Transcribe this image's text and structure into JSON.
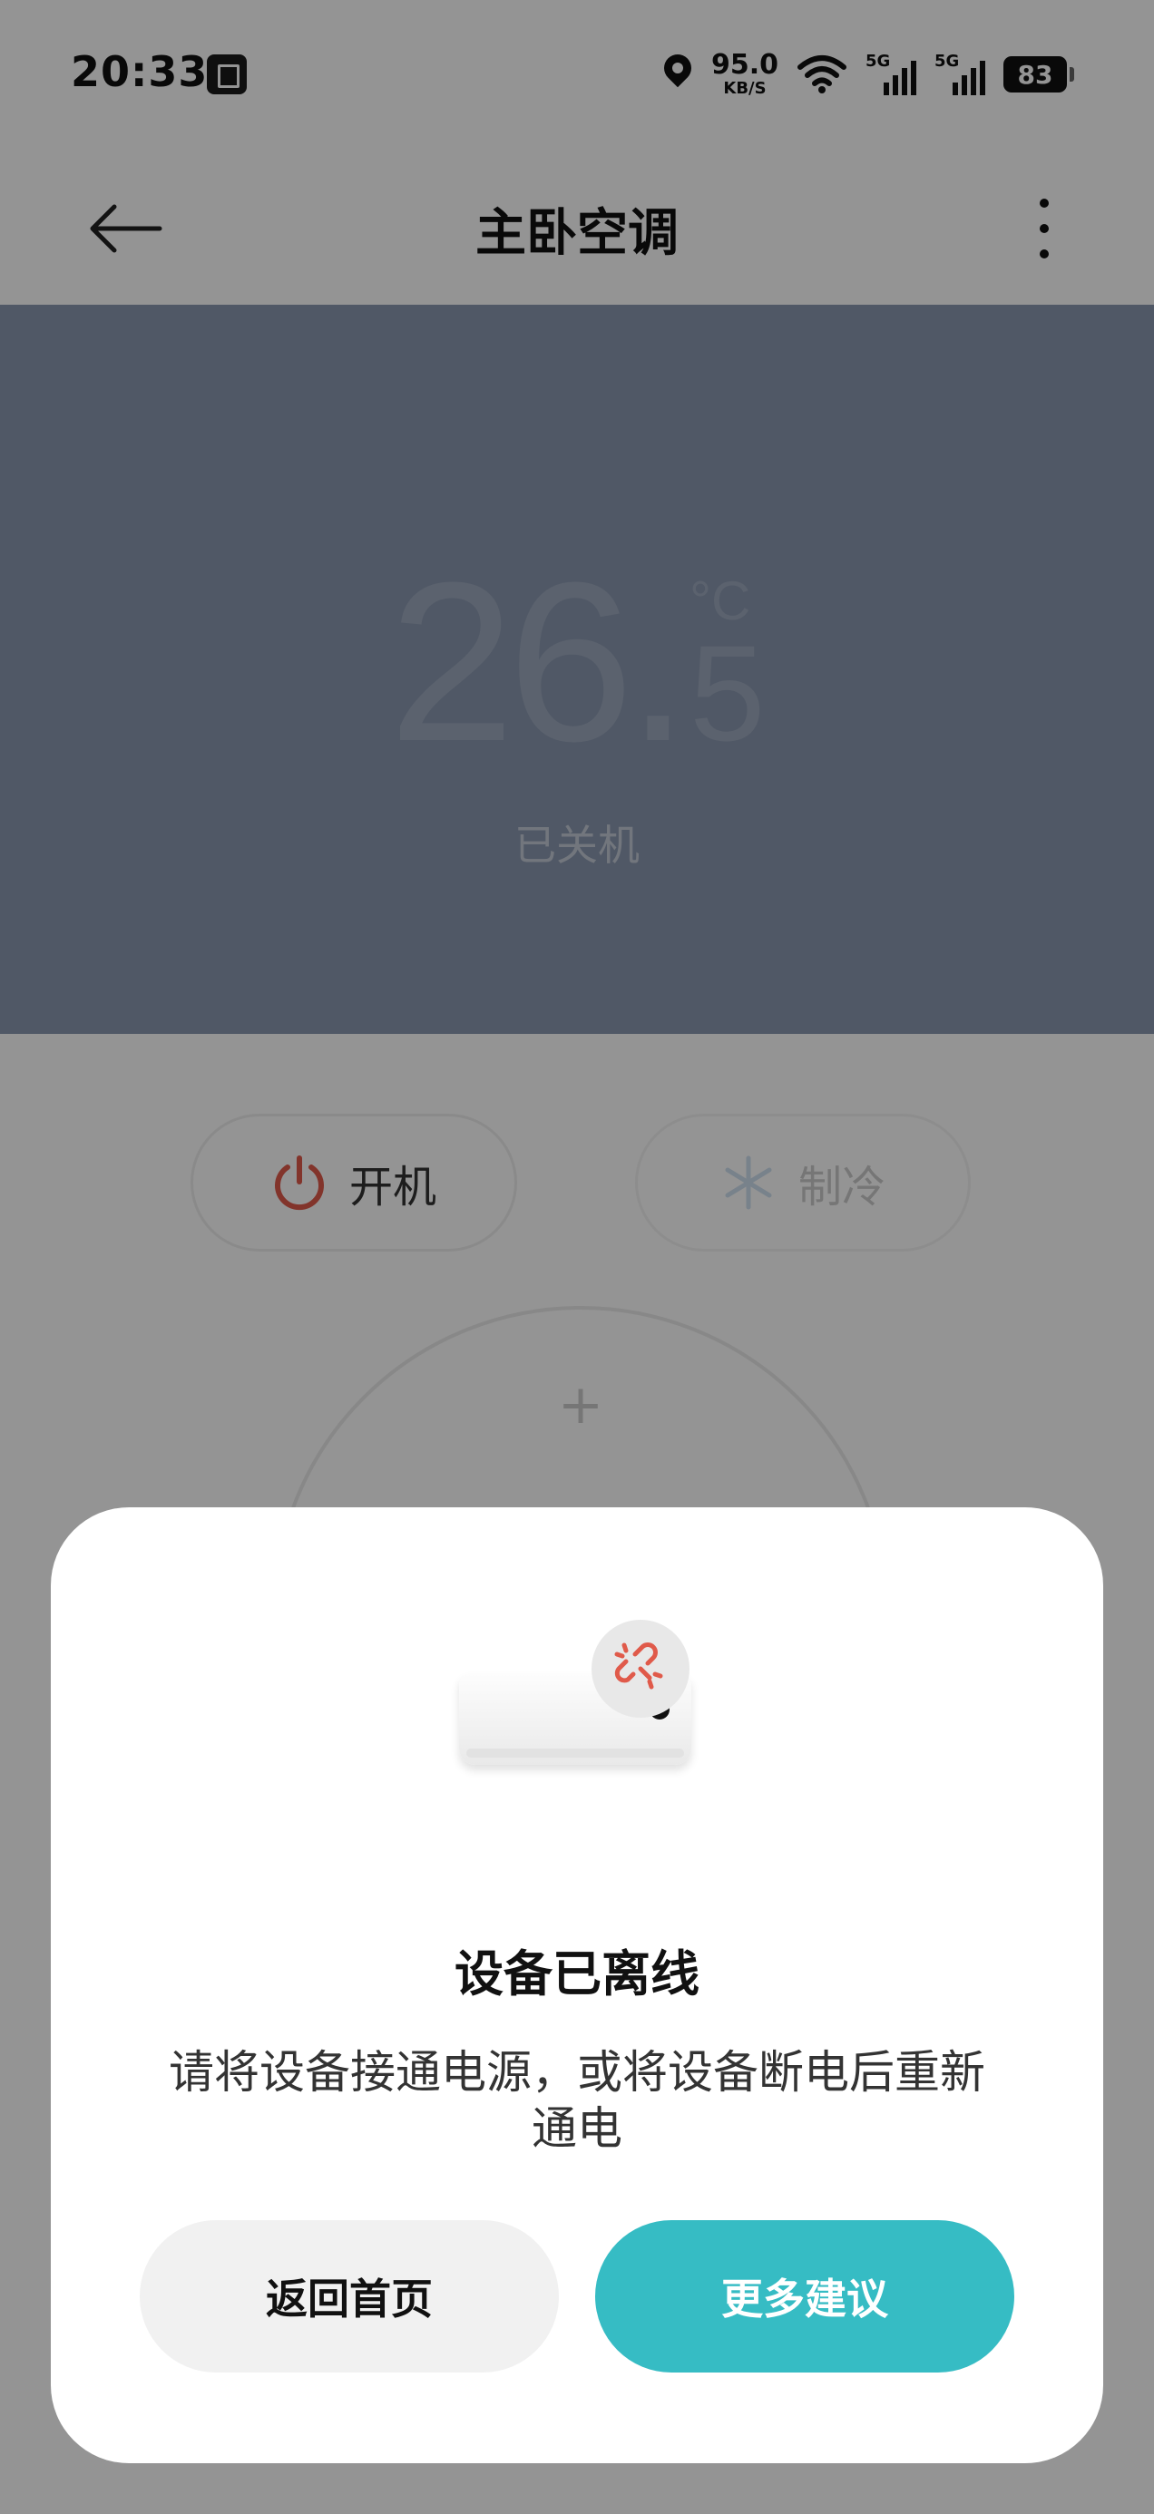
{
  "status_bar": {
    "time": "20:33",
    "net_speed_value": "95.0",
    "net_speed_unit": "KB/S",
    "signal_1_label": "5G",
    "signal_2_label": "5G",
    "battery": "83"
  },
  "app_bar": {
    "title": "主卧空调",
    "back_icon": "arrow-left-icon",
    "more_icon": "more-vertical-icon"
  },
  "hero": {
    "temp_integer": "26",
    "temp_dot": ".",
    "temp_decimal": "5",
    "temp_unit": "°C",
    "state": "已关机"
  },
  "controls": {
    "power_label": "开机",
    "mode_label": "制冷",
    "dial_plus": "+"
  },
  "dialog": {
    "title": "设备已离线",
    "message": "请将设备接通电源，或将设备断电后重新通电",
    "home_button": "返回首页",
    "more_button": "更多建议",
    "accent_color": "#36bcc4",
    "offline_icon_color": "#e05a4a"
  }
}
